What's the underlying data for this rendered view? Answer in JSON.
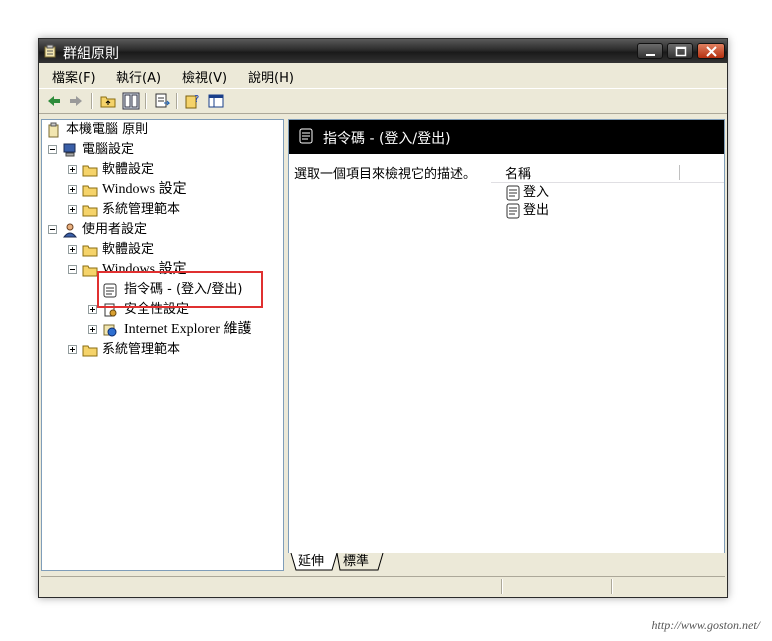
{
  "window": {
    "title": "群組原則"
  },
  "menu": [
    {
      "label": "檔案(F)"
    },
    {
      "label": "執行(A)"
    },
    {
      "label": "檢視(V)"
    },
    {
      "label": "說明(H)"
    }
  ],
  "tree": {
    "root": "本機電腦 原則",
    "computer_config": "電腦設定",
    "cc_software": "軟體設定",
    "cc_windows": "Windows 設定",
    "cc_admin": "系統管理範本",
    "user_config": "使用者設定",
    "uc_software": "軟體設定",
    "uc_windows": "Windows 設定",
    "uc_scripts": "指令碼 - (登入/登出)",
    "uc_security": "安全性設定",
    "uc_ie": "Internet Explorer 維護",
    "uc_admin": "系統管理範本"
  },
  "right_pane": {
    "header": "指令碼 - (登入/登出)",
    "description": "選取一個項目來檢視它的描述。",
    "column_name": "名稱",
    "items": [
      {
        "label": "登入"
      },
      {
        "label": "登出"
      }
    ]
  },
  "tabs": [
    {
      "label": "延伸"
    },
    {
      "label": "標準"
    }
  ],
  "watermark": "http://www.goston.net/",
  "colors": {
    "highlight": "#e03030",
    "titlebar": "#2c2c2c",
    "panel_header": "#000000"
  }
}
